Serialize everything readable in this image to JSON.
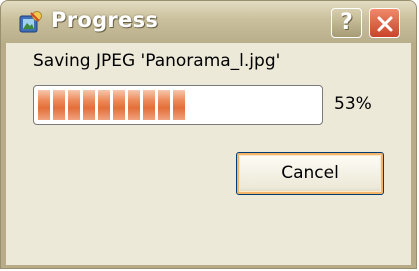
{
  "window": {
    "title": "Progress",
    "help_label": "?",
    "icons": {
      "app": "progress-app-icon",
      "help": "help-icon",
      "close": "close-icon"
    }
  },
  "dialog": {
    "message": "Saving JPEG 'Panorama_l.jpg'",
    "progress": {
      "value": 0.53,
      "label": "53%"
    },
    "cancel_label": "Cancel"
  },
  "colors": {
    "titlebar": "#c9bf9c",
    "client_background": "#ece9d8",
    "progress_fill": "#e36f3a",
    "close_button": "#c9442a"
  }
}
